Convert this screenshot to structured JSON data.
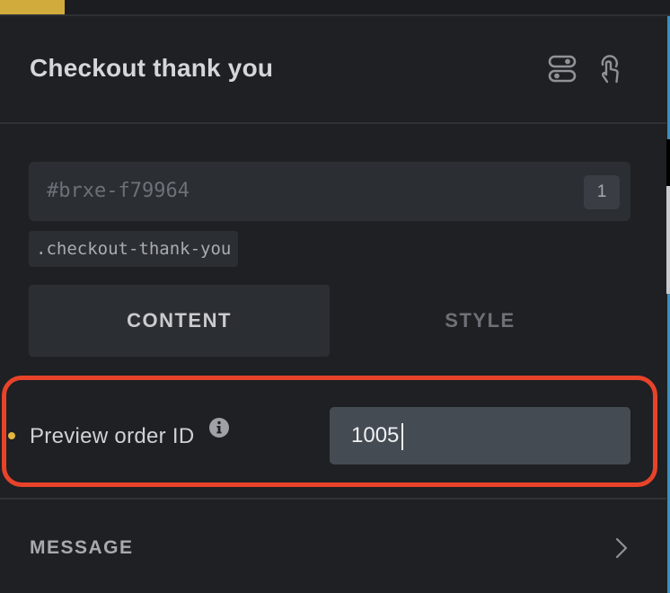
{
  "panel": {
    "title": "Checkout thank you",
    "header_icons": [
      "toggle-icon",
      "pointer-hand-icon"
    ]
  },
  "element": {
    "id": "#brxe-f79964",
    "id_count": "1",
    "class_name": ".checkout-thank-you"
  },
  "tabs": [
    {
      "label": "CONTENT",
      "active": true
    },
    {
      "label": "STYLE",
      "active": false
    }
  ],
  "control": {
    "label": "Preview order ID",
    "info_icon": "info-icon",
    "value": "1005",
    "modified_indicator_color": "#e3b63f"
  },
  "section": {
    "title": "MESSAGE",
    "icon": "chevron-right-icon"
  },
  "colors": {
    "background": "#1e2023",
    "accent": "#d1ac3c",
    "highlight": "#e8432a",
    "input_bg": "#454b53"
  }
}
